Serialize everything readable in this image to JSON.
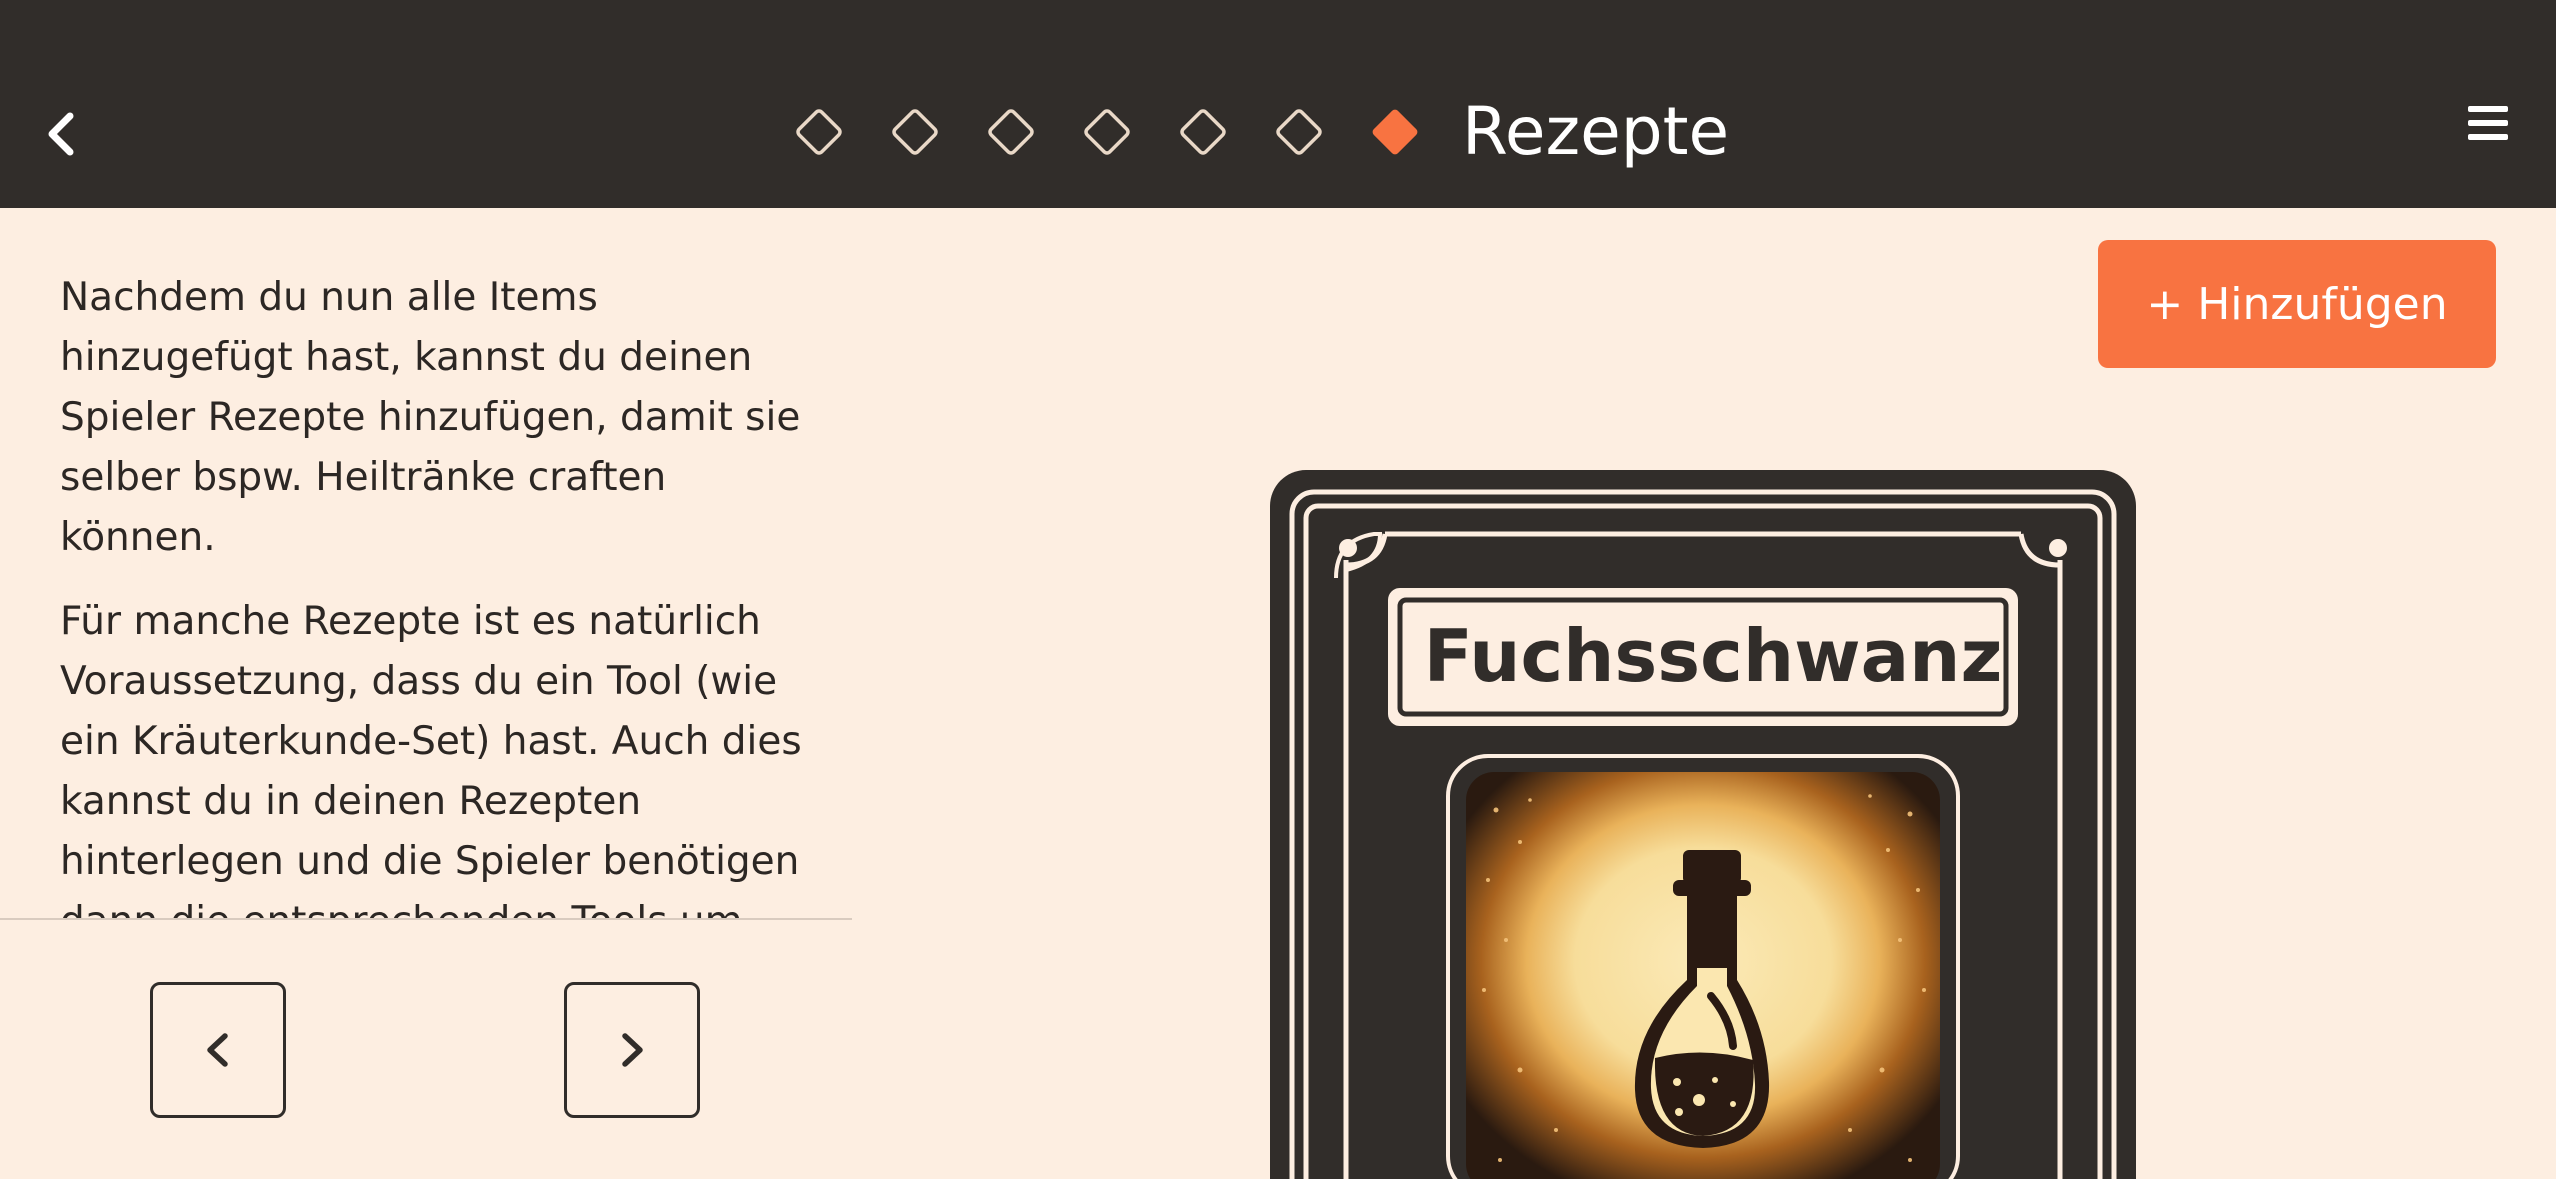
{
  "header": {
    "title": "Rezepte",
    "step_count_completed": 6,
    "active_step_color": "#f87341",
    "back_icon": "chevron-left-icon",
    "menu_icon": "hamburger-menu-icon"
  },
  "actions": {
    "add_label": "+ Hinzufügen"
  },
  "info": {
    "paragraphs": [
      "Nachdem du nun alle Items hinzugefügt hast, kannst du deinen Spieler Rezepte hinzufügen, damit sie selber bspw. Heiltränke craften können.",
      "Für manche Rezepte ist es natürlich Voraussetzung, dass du ein Tool (wie ein Kräuterkunde-Set) hast. Auch dies kannst du in deinen Rezepten hinterlegen und die Spieler benötigen dann die entsprechenden Tools um"
    ]
  },
  "pager": {
    "prev_icon": "chevron-left-icon",
    "next_icon": "chevron-right-icon"
  },
  "card": {
    "title": "Fuchsschwanz",
    "image_icon": "potion-bottle-icon"
  },
  "colors": {
    "header_bg": "#312d2a",
    "page_bg": "#fdeee1",
    "accent": "#f87341",
    "text": "#2c2724"
  }
}
